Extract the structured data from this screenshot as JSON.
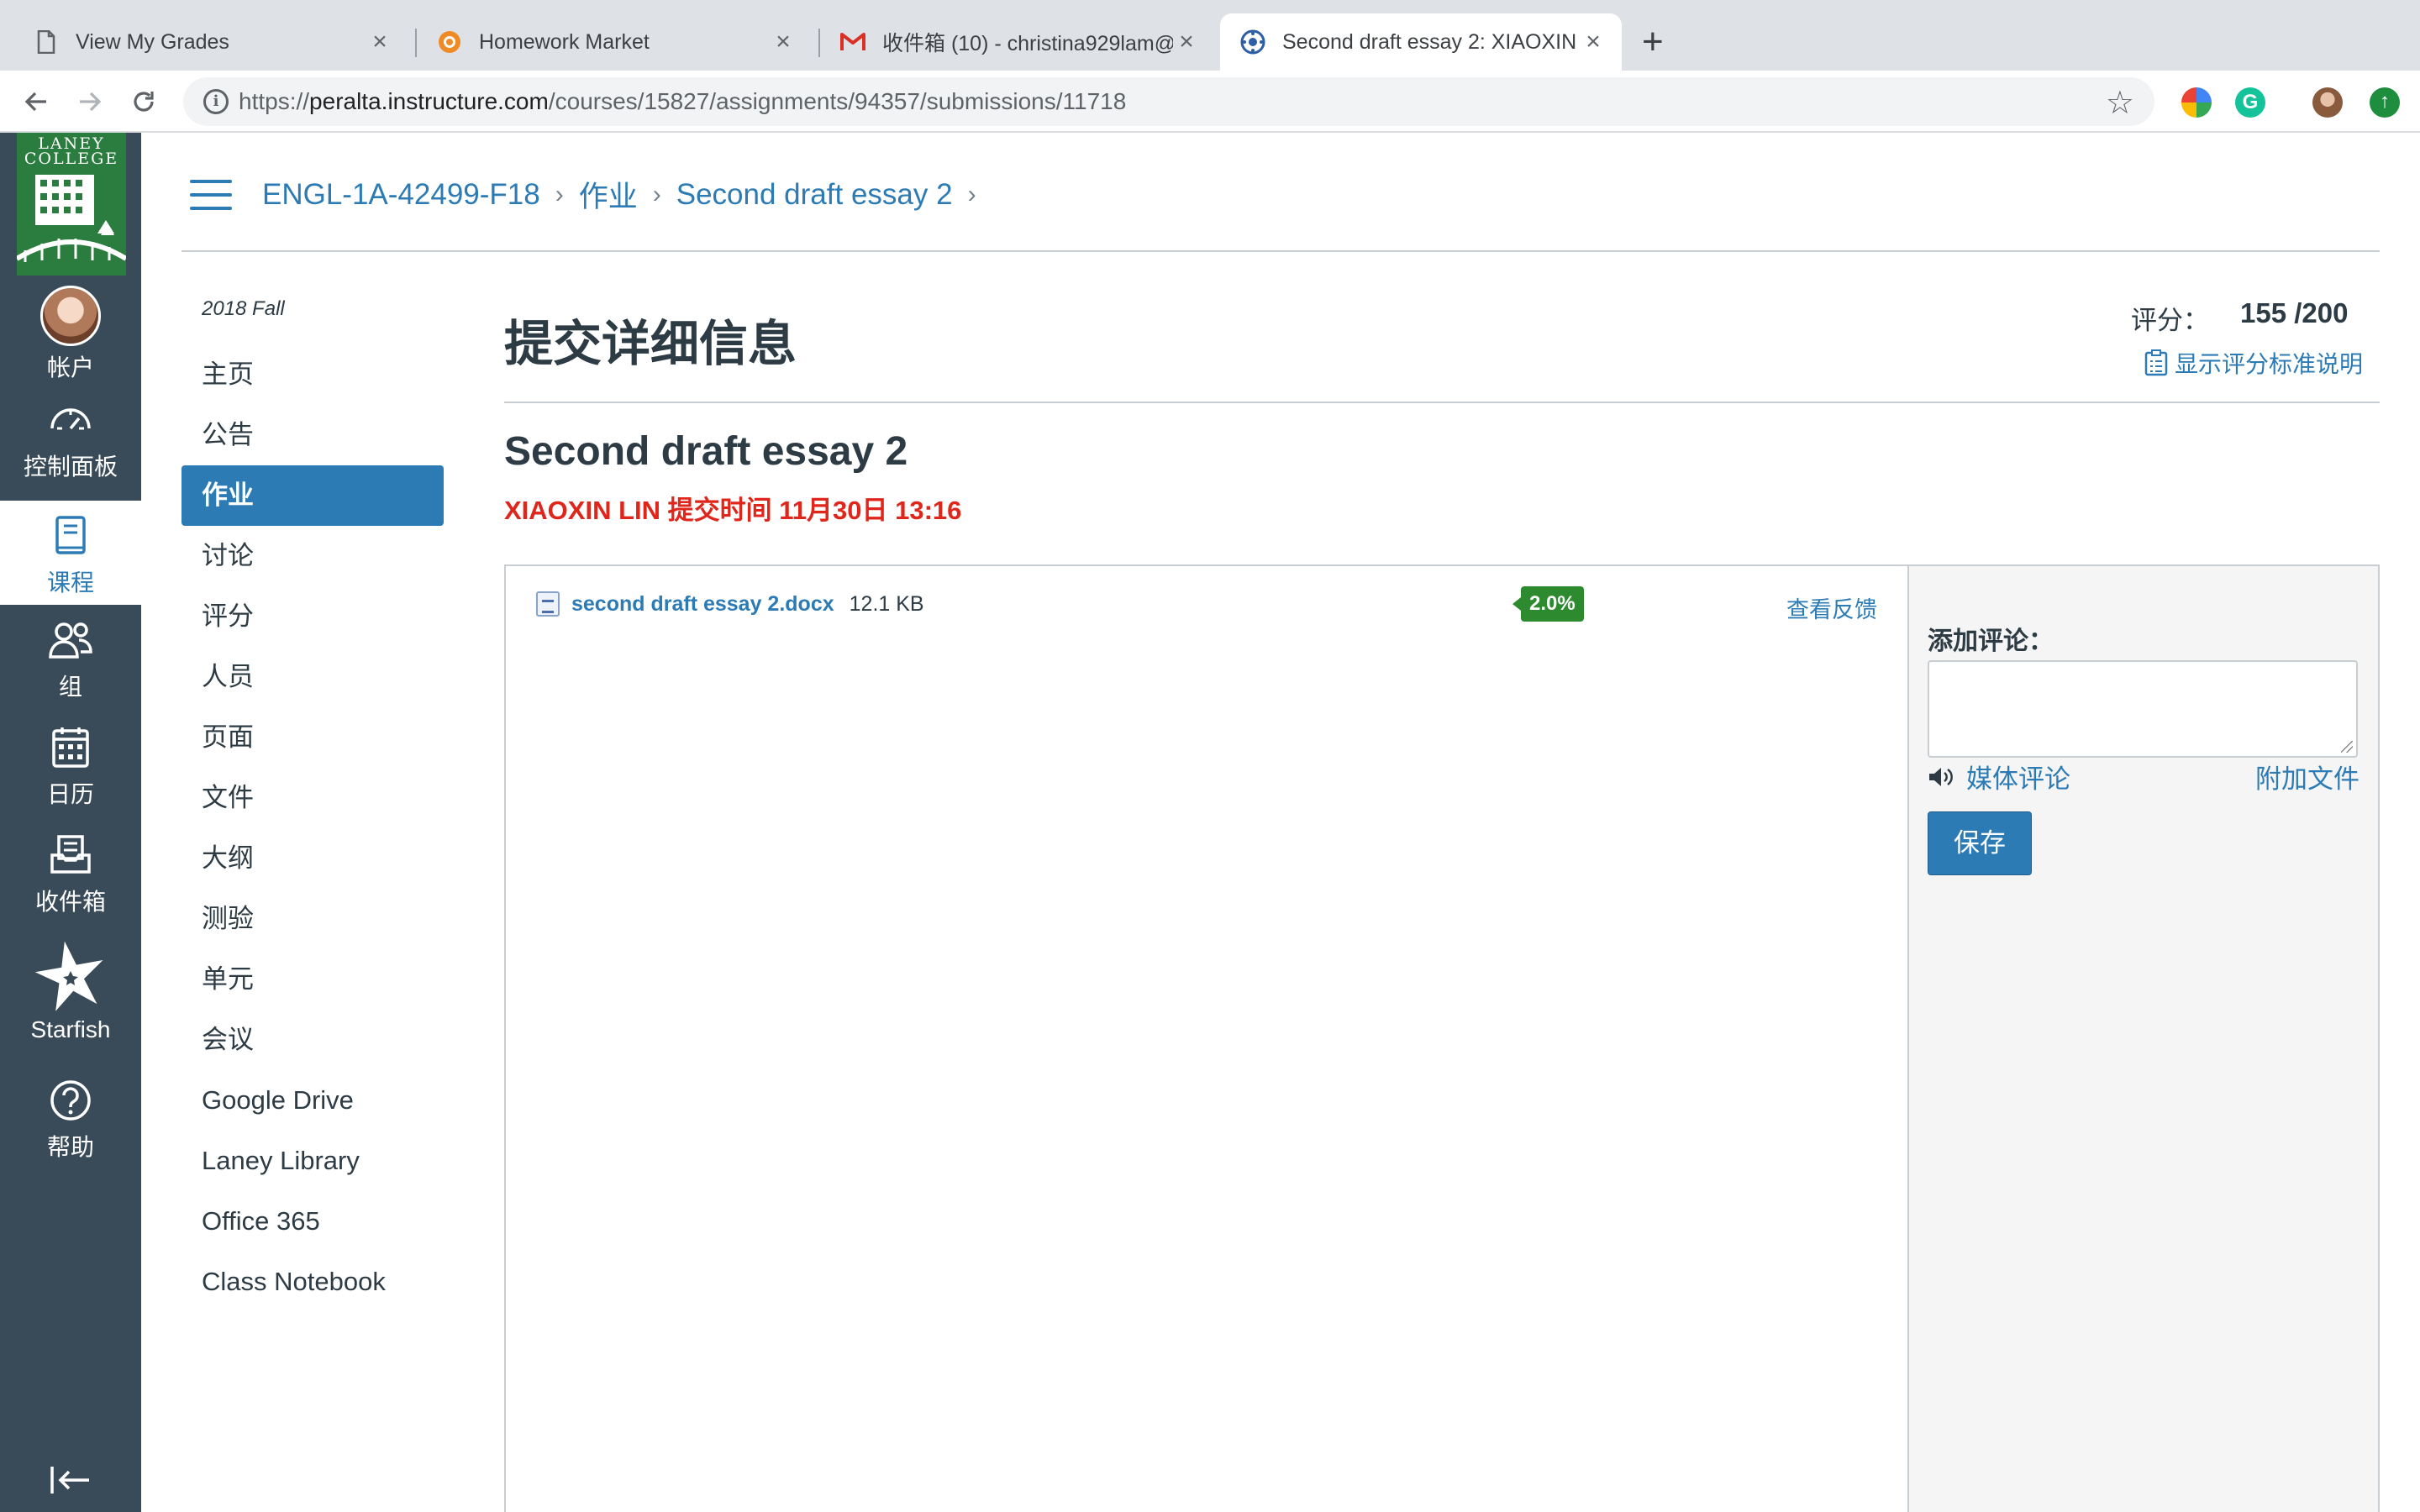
{
  "browser": {
    "tabs": [
      {
        "title": "View My Grades",
        "icon": "page-icon",
        "active": false
      },
      {
        "title": "Homework Market",
        "icon": "homework-market-icon",
        "active": false
      },
      {
        "title": "收件箱 (10) - christina929lam@",
        "icon": "gmail-icon",
        "active": false
      },
      {
        "title": "Second draft essay 2: XIAOXIN",
        "icon": "canvas-icon",
        "active": true
      }
    ],
    "close_glyph": "×",
    "new_tab_glyph": "+",
    "url_scheme": "https://",
    "url_host": "peralta.instructure.com",
    "url_path": "/courses/15827/assignments/94357/submissions/11718"
  },
  "global_nav": {
    "logo_text_1": "LANEY",
    "logo_text_2": "COLLEGE",
    "items": [
      {
        "label": "帐户",
        "icon": "avatar"
      },
      {
        "label": "控制面板",
        "icon": "dashboard-icon"
      },
      {
        "label": "课程",
        "icon": "courses-icon",
        "active": true
      },
      {
        "label": "组",
        "icon": "groups-icon"
      },
      {
        "label": "日历",
        "icon": "calendar-icon"
      },
      {
        "label": "收件箱",
        "icon": "inbox-icon"
      },
      {
        "label": "Starfish",
        "icon": "starfish-icon"
      },
      {
        "label": "帮助",
        "icon": "help-icon"
      }
    ]
  },
  "breadcrumb": [
    "ENGL-1A-42499-F18",
    "作业",
    "Second draft essay 2"
  ],
  "course_nav": {
    "term": "2018 Fall",
    "items": [
      "主页",
      "公告",
      "作业",
      "讨论",
      "评分",
      "人员",
      "页面",
      "文件",
      "大纲",
      "测验",
      "单元",
      "会议",
      "Google Drive",
      "Laney Library",
      "Office 365",
      "Class Notebook"
    ],
    "active_index": 2
  },
  "main": {
    "page_title": "提交详细信息",
    "grade_label": "评分：",
    "grade_value": "155 /200",
    "rubric_link": "显示评分标准说明",
    "assignment_title": "Second draft essay 2",
    "submitted_by": "XIAOXIN LIN 提交时间 11月30日 13:16",
    "file_name": "second draft essay 2.docx",
    "file_size": "12.1 KB",
    "similarity_score": "2.0%",
    "view_feedback": "查看反馈"
  },
  "comments": {
    "label": "添加评论：",
    "media_comment": "媒体评论",
    "attach_file": "附加文件",
    "save": "保存"
  },
  "colors": {
    "canvas_blue": "#2d7bb5",
    "nav_dark": "#394b58",
    "submitted_red": "#e0251b",
    "score_green": "#2d8a2f",
    "laney_green": "#2a7d3e"
  }
}
